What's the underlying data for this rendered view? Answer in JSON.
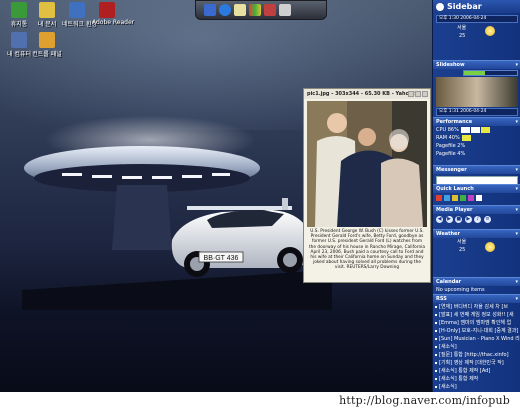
{
  "desktop": {
    "icons": [
      {
        "label": "휴지통",
        "color": "#3a9a3a"
      },
      {
        "label": "내 문서",
        "color": "#e0c040"
      },
      {
        "label": "네트워크 환경",
        "color": "#4070c0"
      },
      {
        "label": "Adobe Reader",
        "color": "#b02020"
      },
      {
        "label": "내 컴퓨터",
        "color": "#5070b0"
      },
      {
        "label": "컨트롤 패널",
        "color": "#e0a030"
      }
    ],
    "car_plate": "BB·GT 436",
    "launcher_icons": [
      "windows-logo",
      "info",
      "note",
      "photo",
      "tools",
      "export"
    ]
  },
  "popup": {
    "title": "pic1.jpg - 303x344 - 65.30 KB - Yahoo Sli",
    "caption": "U.S. President George W. Bush (C) kisses former U.S. President Gerald Ford's wife, Betty Ford, goodbye as former U.S. president Gerald Ford (L) watches from the doorway of his house in Rancho Mirage, California April 23, 2006. Bush paid a courtesy call to Ford and his wife at their California home on Sunday and they joked about having solved all problems during the visit.",
    "credit": "REUTERS/Larry Downing"
  },
  "sidebar": {
    "title": "Sidebar",
    "clock": "오후 1:30 2006-04-24",
    "weather1": {
      "line1": "서울",
      "line2": "25"
    },
    "slideshow_title": "Slideshow",
    "slideshow_clock": "오후 1:31 2006-04-24",
    "performance_title": "Performance",
    "perf_rows": [
      "CPU 86%",
      "RAM 40%",
      "Pagefile 2%",
      "Pagefile 4%"
    ],
    "perf_values": {
      "cpu": 86,
      "ram": 40
    },
    "msn_title": "Messenger",
    "quicklaunch_title": "Quick Launch",
    "mediaplayer_title": "Media Player",
    "weather_title": "Weather",
    "weather2": {
      "line1": "서울",
      "line2": "25"
    },
    "calendar_title": "Calendar",
    "calendar_text": "No upcoming items",
    "rss_title": "RSS",
    "rss_items": [
      "[연재] 버디버디 자율 감세 차 [브",
      "[발표] 세 번째 게임 정보 성화!! [새",
      "[Emma] 엠마의 엠마엠 확인해 업",
      "[H-Only] 보호-지니-대회 [중계 결과]",
      "[Sun] Musician - Piano X Wind 리뷰",
      "[새소식]",
      "[질문] 통합 [http://thac.xinfo]",
      "[기획] 영상 제작 [대한민국 작]",
      "[새소식] 통합 제작 [Ad]",
      "[새소식] 통합 제작",
      "[새소식]"
    ]
  },
  "footer": {
    "url": "http://blog.naver.com/infopub"
  }
}
